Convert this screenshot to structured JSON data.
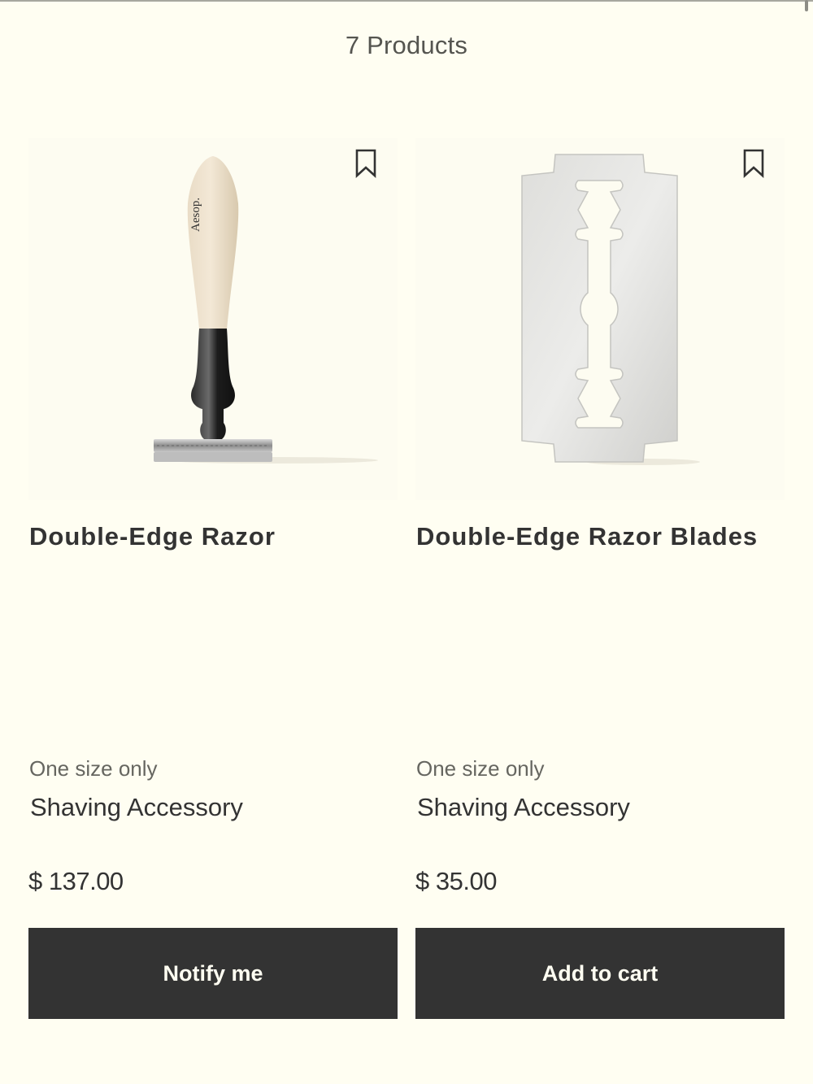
{
  "listing": {
    "count_label": "7 Products"
  },
  "products": [
    {
      "image_icon": "razor-image",
      "brand_mark": "Aesop.",
      "name": "Double-Edge Razor",
      "size": "One size only",
      "category": "Shaving Accessory",
      "price": "$ 137.00",
      "cta_label": "Notify me"
    },
    {
      "image_icon": "razor-blade-image",
      "name": "Double-Edge Razor Blades",
      "size": "One size only",
      "category": "Shaving Accessory",
      "price": "$ 35.00",
      "cta_label": "Add to cart"
    }
  ],
  "colors": {
    "background": "#fffef2",
    "text": "#333333",
    "button": "#333333",
    "button_text": "#fffef2"
  }
}
